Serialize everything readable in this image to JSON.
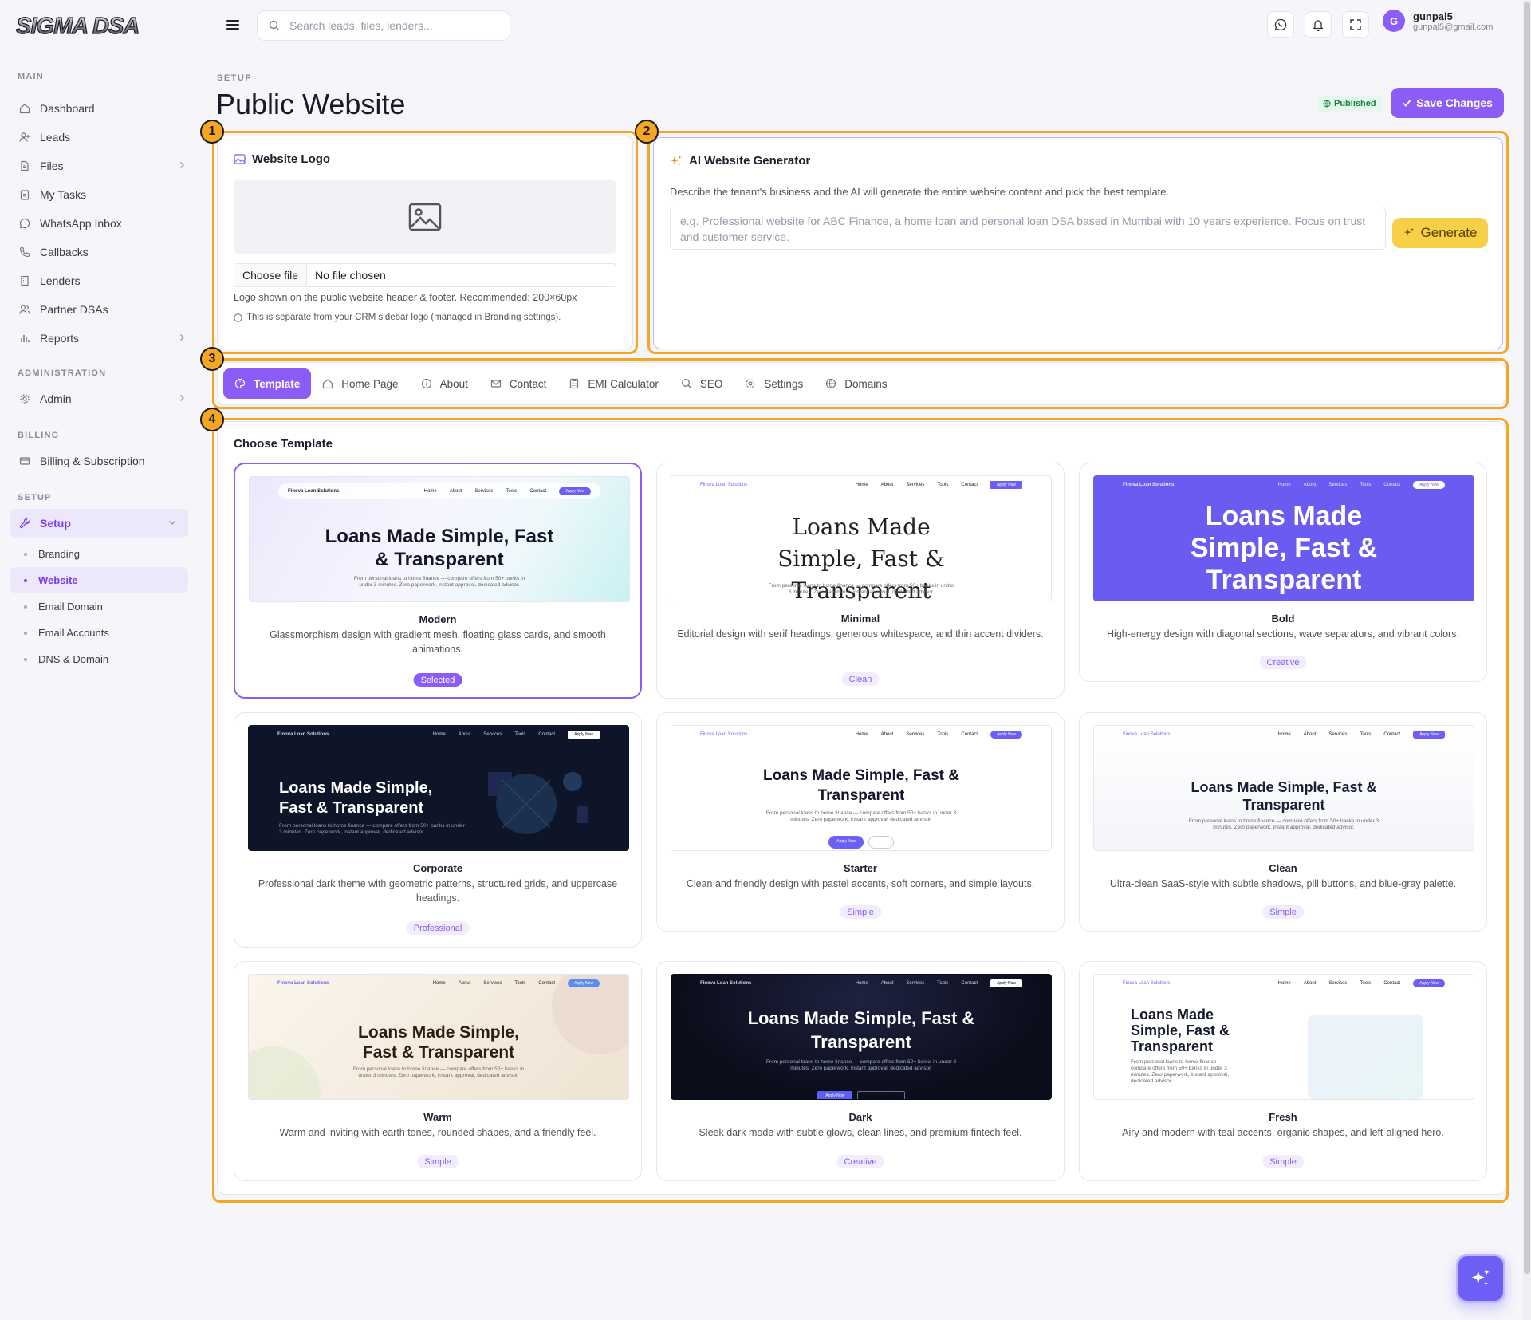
{
  "app": {
    "brand": "SIGMA DSA"
  },
  "topbar": {
    "search_placeholder": "Search leads, files, lenders...",
    "user_initial": "G",
    "user_name": "gunpal5",
    "user_email": "gunpal5@gmail.com"
  },
  "sidebar": {
    "sections": {
      "main": "MAIN",
      "administration": "ADMINISTRATION",
      "billing": "BILLING",
      "setup": "SETUP"
    },
    "main_items": [
      "Dashboard",
      "Leads",
      "Files",
      "My Tasks",
      "WhatsApp Inbox",
      "Callbacks",
      "Lenders",
      "Partner DSAs",
      "Reports"
    ],
    "admin_items": [
      "Admin"
    ],
    "billing_items": [
      "Billing & Subscription"
    ],
    "setup_item": "Setup",
    "setup_sub": [
      "Branding",
      "Website",
      "Email Domain",
      "Email Accounts",
      "DNS & Domain"
    ],
    "active_sub": "Website"
  },
  "header": {
    "breadcrumb": "SETUP",
    "title": "Public Website",
    "status": "Published",
    "save_label": "Save Changes"
  },
  "annotations": [
    "1",
    "2",
    "3",
    "4"
  ],
  "logo_card": {
    "title": "Website Logo",
    "choose_file": "Choose file",
    "no_file": "No file chosen",
    "hint": "Logo shown on the public website header & footer. Recommended: 200×60px",
    "note": "This is separate from your CRM sidebar logo (managed in Branding settings)."
  },
  "ai_card": {
    "title": "AI Website Generator",
    "description": "Describe the tenant's business and the AI will generate the entire website content and pick the best template.",
    "placeholder": "e.g. Professional website for ABC Finance, a home loan and personal loan DSA based in Mumbai with 10 years experience. Focus on trust and customer service.",
    "generate_label": "Generate"
  },
  "tabs": [
    "Template",
    "Home Page",
    "About",
    "Contact",
    "EMI Calculator",
    "SEO",
    "Settings",
    "Domains"
  ],
  "active_tab": "Template",
  "templates_section": {
    "title": "Choose Template",
    "preview_brand": "Finova Loan Solutions",
    "preview_links": [
      "Home",
      "About",
      "Services",
      "Tools",
      "Contact"
    ],
    "preview_apply": "Apply Now",
    "preview_heading": "Loans Made Simple, Fast & Transparent",
    "preview_sub": "From personal loans to home finance — compare offers from 50+ banks in under 3 minutes. Zero paperwork, instant approval, dedicated advisor.",
    "templates": [
      {
        "name": "Modern",
        "description": "Glassmorphism design with gradient mesh, floating glass cards, and smooth animations.",
        "badge": "Selected",
        "selected": true
      },
      {
        "name": "Minimal",
        "description": "Editorial design with serif headings, generous whitespace, and thin accent dividers.",
        "badge": "Clean",
        "selected": false
      },
      {
        "name": "Bold",
        "description": "High-energy design with diagonal sections, wave separators, and vibrant colors.",
        "badge": "Creative",
        "selected": false
      },
      {
        "name": "Corporate",
        "description": "Professional dark theme with geometric patterns, structured grids, and uppercase headings.",
        "badge": "Professional",
        "selected": false
      },
      {
        "name": "Starter",
        "description": "Clean and friendly design with pastel accents, soft corners, and simple layouts.",
        "badge": "Simple",
        "selected": false
      },
      {
        "name": "Clean",
        "description": "Ultra-clean SaaS-style with subtle shadows, pill buttons, and blue-gray palette.",
        "badge": "Simple",
        "selected": false
      },
      {
        "name": "Warm",
        "description": "Warm and inviting with earth tones, rounded shapes, and a friendly feel.",
        "badge": "Simple",
        "selected": false
      },
      {
        "name": "Dark",
        "description": "Sleek dark mode with subtle glows, clean lines, and premium fintech feel.",
        "badge": "Creative",
        "selected": false
      },
      {
        "name": "Fresh",
        "description": "Airy and modern with teal accents, organic shapes, and left-aligned hero.",
        "badge": "Simple",
        "selected": false
      }
    ]
  },
  "colors": {
    "accent": "#8b5cf6",
    "highlight": "#f5a623",
    "generate": "#f8d047",
    "published": "#16813d"
  }
}
